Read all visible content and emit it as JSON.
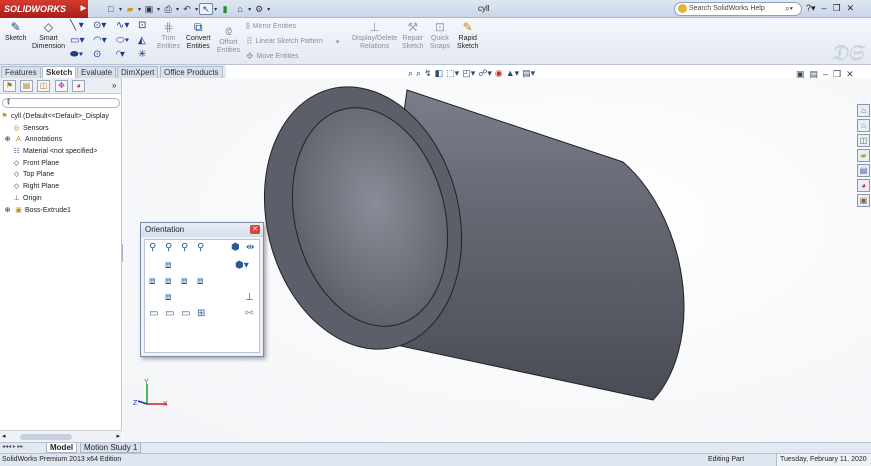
{
  "app": {
    "logo": "SOLIDWORKS",
    "title": "cyll"
  },
  "search": {
    "placeholder": "Search SolidWorks Help"
  },
  "ribbon": {
    "sketch": "Sketch",
    "smart_dimension": [
      "Smart",
      "Dimension"
    ],
    "trim": [
      "Trim",
      "Entities"
    ],
    "convert": [
      "Convert",
      "Entities"
    ],
    "offset": [
      "Offset",
      "Entities"
    ],
    "mirror": "Mirror Entities",
    "linear_pattern": "Linear Sketch Pattern",
    "move": "Move Entities",
    "display_delete": [
      "Display/Delete",
      "Relations"
    ],
    "repair": [
      "Repair",
      "Sketch"
    ],
    "quick_snaps": [
      "Quick",
      "Snaps"
    ],
    "rapid": [
      "Rapid",
      "Sketch"
    ]
  },
  "tabs": [
    "Features",
    "Sketch",
    "Evaluate",
    "DimXpert",
    "Office Products"
  ],
  "active_tab": "Sketch",
  "tree": [
    {
      "label": "cyll  (Default<<Default>_Display",
      "icon": "part-icon"
    },
    {
      "label": "Sensors",
      "icon": "sensor-icon"
    },
    {
      "label": "Annotations",
      "icon": "annotation-icon"
    },
    {
      "label": "Material <not specified>",
      "icon": "material-icon"
    },
    {
      "label": "Front Plane",
      "icon": "plane-icon"
    },
    {
      "label": "Top Plane",
      "icon": "plane-icon"
    },
    {
      "label": "Right Plane",
      "icon": "plane-icon"
    },
    {
      "label": "Origin",
      "icon": "origin-icon"
    },
    {
      "label": "Boss-Extrude1",
      "icon": "extrude-icon"
    }
  ],
  "orientation": {
    "title": "Orientation"
  },
  "bottom_tabs": [
    "Model",
    "Motion Study 1"
  ],
  "status": {
    "left": "SolidWorks Premium 2013 x64 Edition",
    "mode": "Editing Part",
    "date": "Tuesday, February 11, 2020"
  },
  "colors": {
    "brand": "#c8302a",
    "model": "#6e7180"
  }
}
